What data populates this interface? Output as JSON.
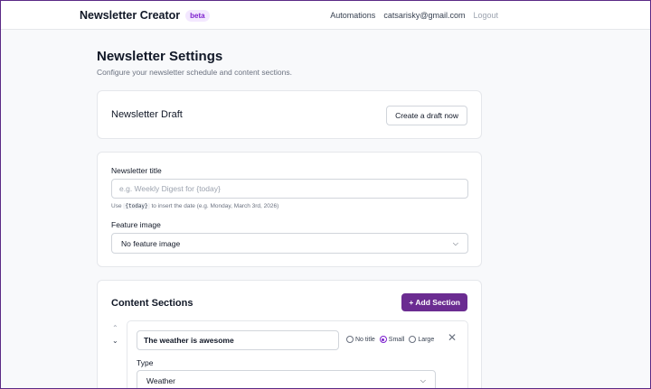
{
  "nav": {
    "brand": "Newsletter Creator",
    "badge": "beta",
    "links": [
      "Automations",
      "catsarisky@gmail.com",
      "Logout"
    ]
  },
  "header": {
    "title": "Newsletter Settings",
    "subtitle": "Configure your newsletter schedule and content sections."
  },
  "draft": {
    "title": "Newsletter Draft",
    "button": "Create a draft now"
  },
  "fields": {
    "title_label": "Newsletter title",
    "title_value": "",
    "title_placeholder": "e.g. Weekly Digest for {today}",
    "hint_before": "Use",
    "hint_code": "{today}",
    "hint_after": "to insert the date (e.g. Monday, March 3rd, 2026)",
    "image_label": "Feature image",
    "image_selected": "No feature image"
  },
  "sections": {
    "title": "Content Sections",
    "add_button": "+ Add Section",
    "items": [
      {
        "name": "The weather is awesome",
        "title_options": [
          "No title",
          "Small",
          "Large"
        ],
        "title_selected": "Small",
        "type_label": "Type",
        "type_selected": "Weather"
      }
    ]
  },
  "icons": {
    "up": "chevron-up-icon",
    "down": "chevron-down-icon",
    "close": "close-icon",
    "select": "chevron-down-icon"
  },
  "colors": {
    "accent": "#6b2c91",
    "badge_bg": "#f3e8ff",
    "badge_text": "#7e22ce"
  }
}
